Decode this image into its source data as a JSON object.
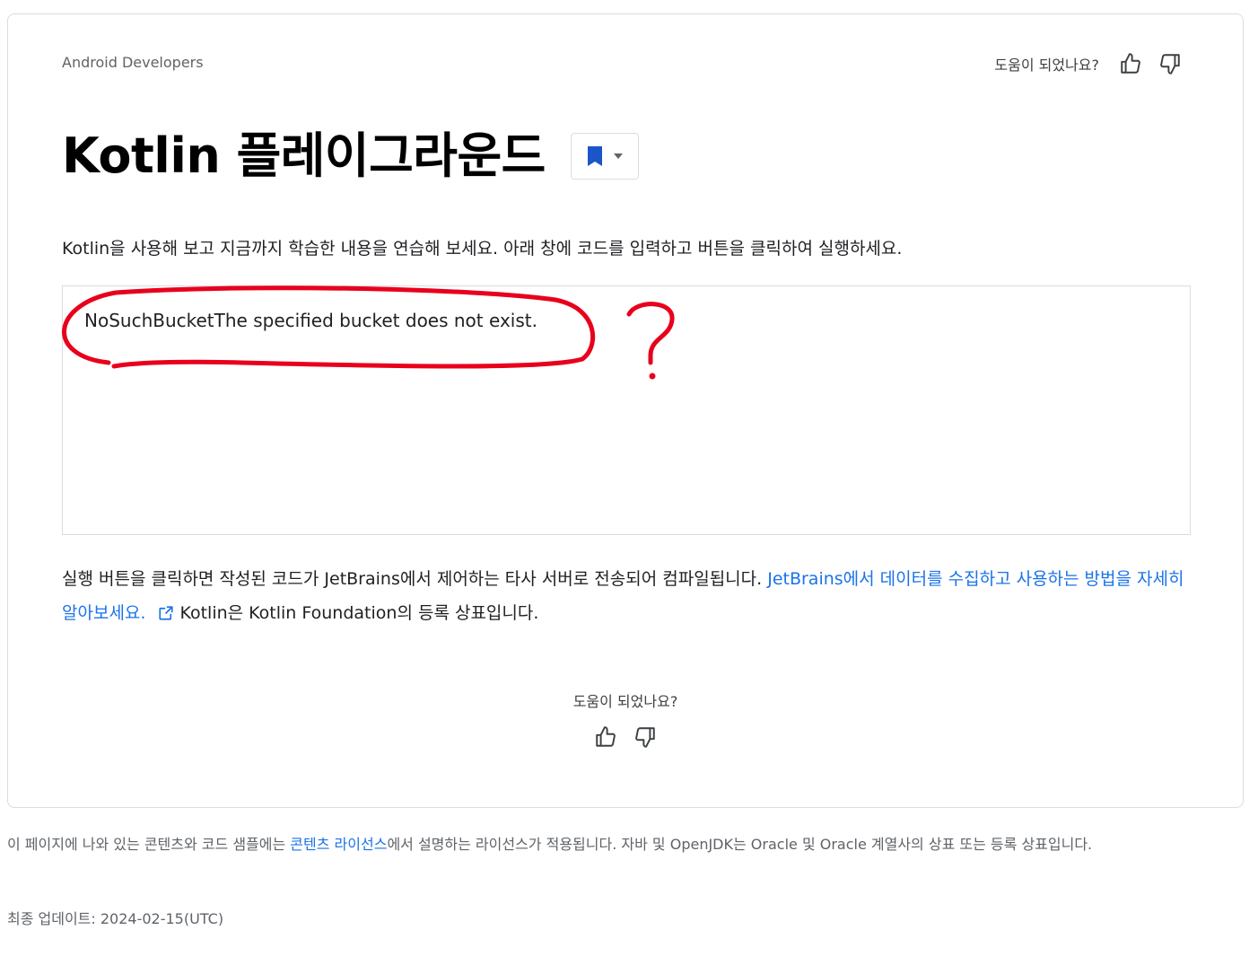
{
  "breadcrumb": "Android Developers",
  "helpful": {
    "question": "도움이 되었나요?",
    "up_icon": "thumb-up-icon",
    "down_icon": "thumb-down-icon"
  },
  "title": "Kotlin 플레이그라운드",
  "intro": "Kotlin을 사용해 보고 지금까지 학습한 내용을 연습해 보세요. 아래 창에 코드를 입력하고 버튼을 클릭하여 실행하세요.",
  "editor": {
    "content": "NoSuchBucketThe specified bucket does not exist."
  },
  "annotation": {
    "mark": "?",
    "color": "#e8001c"
  },
  "notice": {
    "text1": "실행 버튼을 클릭하면 작성된 코드가 JetBrains에서 제어하는 타사 서버로 전송되어 컴파일됩니다. ",
    "link": "JetBrains에서 데이터를 수집하고 사용하는 방법을 자세히 알아보세요.",
    "text2": "Kotlin은 Kotlin Foundation의 등록 상표입니다."
  },
  "footer": {
    "license_text1": "이 페이지에 나와 있는 콘텐츠와 코드 샘플에는 ",
    "license_link": "콘텐츠 라이선스",
    "license_text2": "에서 설명하는 라이선스가 적용됩니다. 자바 및 OpenJDK는 Oracle 및 Oracle 계열사의 상표 또는 등록 상표입니다.",
    "updated": "최종 업데이트: 2024-02-15(UTC)"
  },
  "colors": {
    "link": "#1a73e8",
    "bookmark": "#1a56c9"
  }
}
